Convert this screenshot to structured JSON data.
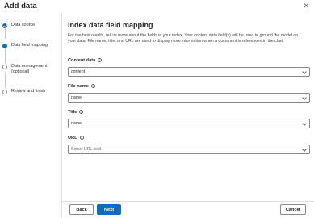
{
  "dialog": {
    "title": "Add data",
    "close_glyph": "✕"
  },
  "steps": [
    {
      "label": "Data source",
      "state": "done"
    },
    {
      "label": "Data field mapping",
      "state": "current"
    },
    {
      "label": "Data management (optional)",
      "state": "todo"
    },
    {
      "label": "Review and finish",
      "state": "todo"
    }
  ],
  "main": {
    "heading": "Index data field mapping",
    "description": "For the best results, tell us more about the fields in your index. Your content data field(s) will be used to ground the model on your data. File name, title, and URL are used to display more information when a document is referenced in the chat.",
    "fields": [
      {
        "label": "Content data",
        "value": "content",
        "placeholder": false
      },
      {
        "label": "File name",
        "value": "name",
        "placeholder": false
      },
      {
        "label": "Title",
        "value": "name",
        "placeholder": false
      },
      {
        "label": "URL",
        "value": "Select URL field",
        "placeholder": true
      }
    ]
  },
  "footer": {
    "back_label": "Back",
    "next_label": "Next",
    "cancel_label": "Cancel"
  },
  "colors": {
    "accent": "#0f6cbd",
    "border": "#8a8886",
    "divider": "#e1dfdd"
  },
  "icons": {
    "info": "info-icon",
    "close": "close-icon",
    "chevron": "chevron-down-icon",
    "check": "check-icon"
  }
}
